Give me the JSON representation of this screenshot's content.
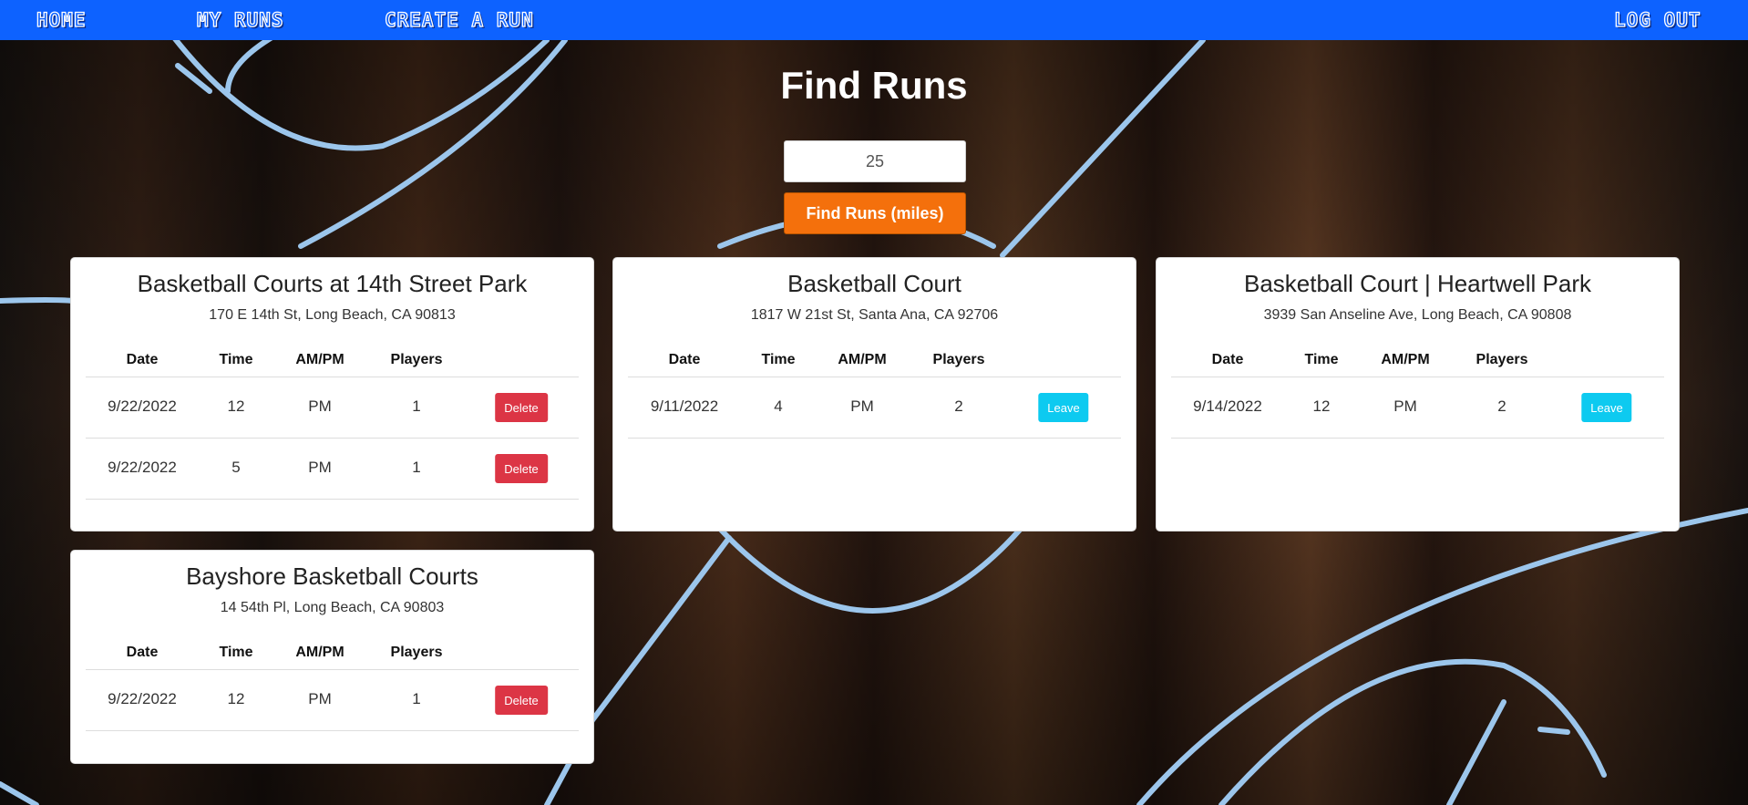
{
  "nav": {
    "home": "Home",
    "my_runs": "My Runs",
    "create_run": "Create A Run",
    "logout": "Log Out"
  },
  "main": {
    "title": "Find Runs",
    "search": {
      "value": "25",
      "button_label": "Find Runs (miles)"
    }
  },
  "table_headers": [
    "Date",
    "Time",
    "AM/PM",
    "Players"
  ],
  "courts": [
    {
      "name": "Basketball Courts at 14th Street Park",
      "address": "170 E 14th St, Long Beach, CA 90813",
      "runs": [
        {
          "date": "9/22/2022",
          "time": "12",
          "ampm": "PM",
          "players": "1",
          "action": "Delete"
        },
        {
          "date": "9/22/2022",
          "time": "5",
          "ampm": "PM",
          "players": "1",
          "action": "Delete"
        }
      ]
    },
    {
      "name": "Basketball Court",
      "address": "1817 W 21st St, Santa Ana, CA 92706",
      "runs": [
        {
          "date": "9/11/2022",
          "time": "4",
          "ampm": "PM",
          "players": "2",
          "action": "Leave"
        }
      ]
    },
    {
      "name": "Basketball Court | Heartwell Park",
      "address": "3939 San Anseline Ave, Long Beach, CA 90808",
      "runs": [
        {
          "date": "9/14/2022",
          "time": "12",
          "ampm": "PM",
          "players": "2",
          "action": "Leave"
        }
      ]
    },
    {
      "name": "Bayshore Basketball Courts",
      "address": "14 54th Pl, Long Beach, CA 90803",
      "runs": [
        {
          "date": "9/22/2022",
          "time": "12",
          "ampm": "PM",
          "players": "1",
          "action": "Delete"
        }
      ]
    }
  ],
  "colors": {
    "nav": "#0d62ff",
    "find_button": "#f4700c",
    "delete": "#dc3545",
    "leave": "#0dcaf0"
  }
}
